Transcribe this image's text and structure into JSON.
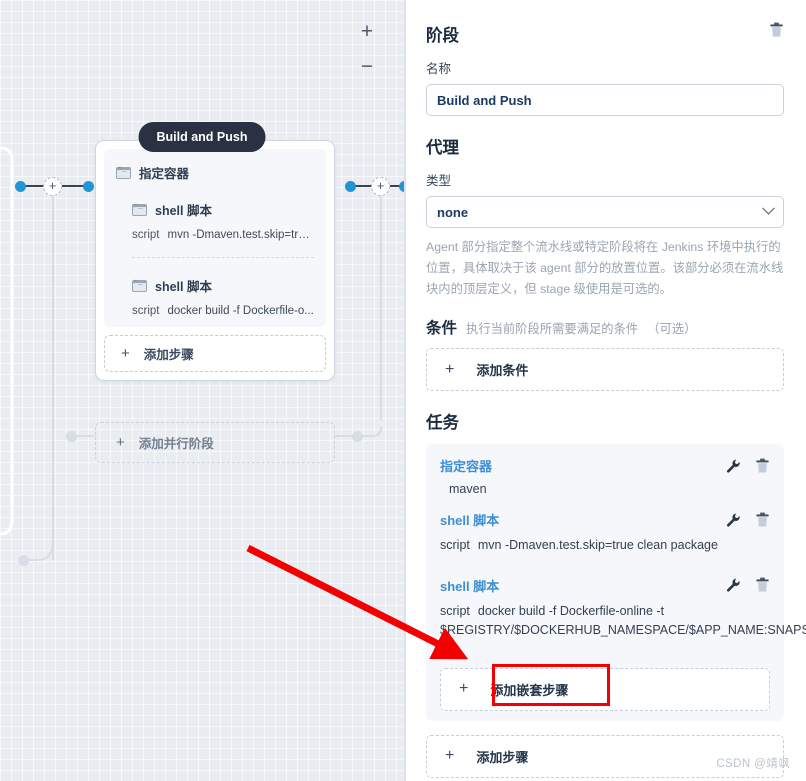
{
  "canvas": {
    "zoom_in_label": "+",
    "zoom_out_label": "−",
    "stage": {
      "title": "Build and Push",
      "steps": [
        {
          "icon": "terminal-icon",
          "label": "指定容器"
        },
        {
          "icon": "terminal-icon",
          "label": "shell 脚本",
          "script_key": "script",
          "script_value": "mvn -Dmaven.test.skip=tru..."
        },
        {
          "icon": "terminal-icon",
          "label": "shell 脚本",
          "script_key": "script",
          "script_value": "docker build -f Dockerfile-o..."
        }
      ],
      "add_step_label": "添加步骤",
      "plus_glyph": "+"
    },
    "add_parallel_stage_label": "添加并行阶段"
  },
  "panel": {
    "section_stage_title": "阶段",
    "delete_stage_icon": "trash-icon",
    "name_label": "名称",
    "name_value": "Build and Push",
    "section_agent_title": "代理",
    "type_label": "类型",
    "type_value": "none",
    "type_options": [
      "none"
    ],
    "agent_help": "Agent 部分指定整个流水线或特定阶段将在 Jenkins 环境中执行的位置，具体取决于该 agent 部分的放置位置。该部分必须在流水线块内的顶层定义，但 stage 级使用是可选的。",
    "condition_title": "条件",
    "condition_subtitle": "执行当前阶段所需要满足的条件",
    "condition_optional": "（可选）",
    "add_condition_label": "添加条件",
    "tasks_title": "任务",
    "plus_glyph": "+",
    "tasks": [
      {
        "name": "指定容器",
        "edit_icon": "wrench-icon",
        "delete_icon": "trash-icon",
        "sub_value": "maven"
      },
      {
        "name": "shell 脚本",
        "edit_icon": "wrench-icon",
        "delete_icon": "trash-icon",
        "script_key": "script",
        "script_value": "mvn -Dmaven.test.skip=true clean package"
      },
      {
        "name": "shell 脚本",
        "edit_icon": "wrench-icon",
        "delete_icon": "trash-icon",
        "script_key": "script",
        "script_value": "docker build -f Dockerfile-online -t $REGISTRY/$DOCKERHUB_NAMESPACE/$APP_NAME:SNAPSHOT-$BUILD_NUMBER ."
      }
    ],
    "add_nested_step_label": "添加嵌套步骤",
    "add_step_label": "添加步骤"
  },
  "annotation": {
    "highlight_color": "#f50000",
    "arrow_color": "#f50000"
  },
  "watermark": "CSDN @靖飒",
  "colors": {
    "canvas_bg": "#e9edf1",
    "node_dot": "#2196d6",
    "pill_bg": "#2a3142",
    "task_link": "#3d8fd3",
    "accent_red": "#f50000"
  }
}
